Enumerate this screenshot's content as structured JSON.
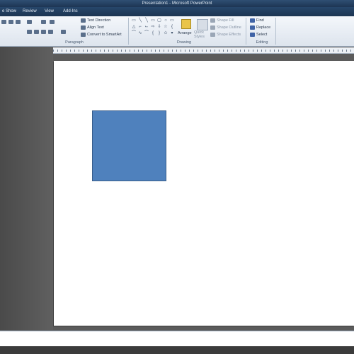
{
  "window": {
    "title": "Presentation1 - Microsoft PowerPoint"
  },
  "tabs": [
    "e Show",
    "Review",
    "View",
    "Add-Ins"
  ],
  "ribbon": {
    "paragraph": {
      "label": "Paragraph",
      "text_direction": "Text Direction",
      "align_text": "Align Text",
      "convert_smartart": "Convert to SmartArt"
    },
    "drawing": {
      "label": "Drawing",
      "arrange": "Arrange",
      "quick_styles": "Quick Styles",
      "shape_fill": "Shape Fill",
      "shape_outline": "Shape Outline",
      "shape_effects": "Shape Effects"
    },
    "editing": {
      "label": "Editing",
      "find": "Find",
      "replace": "Replace",
      "select": "Select"
    }
  },
  "slide": {
    "shape": {
      "type": "rectangle",
      "fill": "#4f81bd",
      "border": "#385d8a"
    }
  }
}
